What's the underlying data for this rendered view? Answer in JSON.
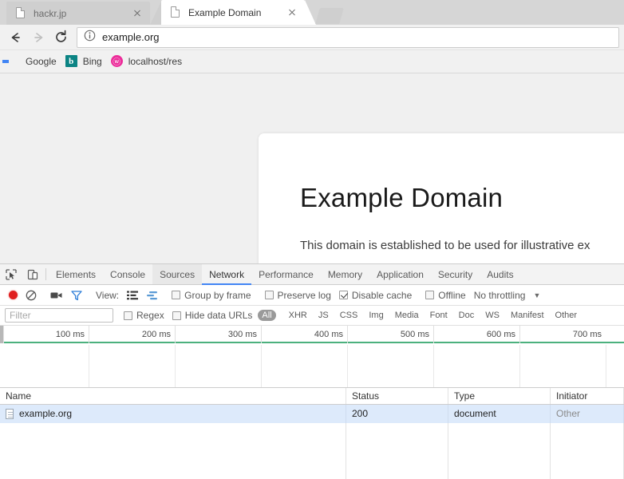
{
  "browser": {
    "tabs": [
      {
        "title": "hackr.jp",
        "active": false,
        "favicon": "page-icon"
      },
      {
        "title": "Example Domain",
        "active": true,
        "favicon": "page-icon"
      }
    ],
    "newtab_label": "New tab",
    "nav": {
      "back": "Back",
      "forward": "Forward",
      "reload": "Reload"
    },
    "omnibox": {
      "url": "example.org",
      "security_icon": "info-icon"
    },
    "bookmarks": [
      {
        "label": "Google",
        "icon": "google-icon",
        "glyph": ""
      },
      {
        "label": "Bing",
        "icon": "bing-icon",
        "glyph": "b"
      },
      {
        "label": "localhost/res",
        "icon": "localhost-icon",
        "glyph": "ⓦ"
      }
    ]
  },
  "page": {
    "heading": "Example Domain",
    "paragraph": "This domain is established to be used for illustrative ex"
  },
  "devtools": {
    "tabs": [
      {
        "label": "Elements",
        "state": "normal"
      },
      {
        "label": "Console",
        "state": "normal"
      },
      {
        "label": "Sources",
        "state": "hover"
      },
      {
        "label": "Network",
        "state": "active"
      },
      {
        "label": "Performance",
        "state": "normal"
      },
      {
        "label": "Memory",
        "state": "normal"
      },
      {
        "label": "Application",
        "state": "normal"
      },
      {
        "label": "Security",
        "state": "normal"
      },
      {
        "label": "Audits",
        "state": "normal"
      }
    ],
    "toolbar": {
      "record_title": "Stop recording network log",
      "clear_title": "Clear",
      "capture_screenshots_title": "Capture screenshots",
      "filter_title": "Filter",
      "view_label": "View:",
      "view_list_title": "List view",
      "view_waterfall_title": "Waterfall view",
      "group_by_frame_label": "Group by frame",
      "group_by_frame_checked": false,
      "preserve_log_label": "Preserve log",
      "preserve_log_checked": false,
      "disable_cache_label": "Disable cache",
      "disable_cache_checked": true,
      "offline_label": "Offline",
      "offline_checked": false,
      "throttling_label": "No throttling",
      "throttling_caret": "▼"
    },
    "filterbar": {
      "filter_placeholder": "Filter",
      "filter_value": "",
      "regex_label": "Regex",
      "regex_checked": false,
      "hide_data_urls_label": "Hide data URLs",
      "hide_data_urls_checked": false,
      "types": [
        {
          "label": "All",
          "selected": true
        },
        {
          "label": "XHR",
          "selected": false
        },
        {
          "label": "JS",
          "selected": false
        },
        {
          "label": "CSS",
          "selected": false
        },
        {
          "label": "Img",
          "selected": false
        },
        {
          "label": "Media",
          "selected": false
        },
        {
          "label": "Font",
          "selected": false
        },
        {
          "label": "Doc",
          "selected": false
        },
        {
          "label": "WS",
          "selected": false
        },
        {
          "label": "Manifest",
          "selected": false
        },
        {
          "label": "Other",
          "selected": false
        }
      ]
    },
    "overview": {
      "ticks": [
        "100 ms",
        "200 ms",
        "300 ms",
        "400 ms",
        "500 ms",
        "600 ms",
        "700 ms"
      ],
      "load_line_color": "#4cb17e"
    },
    "requests": {
      "columns": [
        "Name",
        "Status",
        "Type",
        "Initiator"
      ],
      "rows": [
        {
          "name": "example.org",
          "status": "200",
          "type": "document",
          "initiator": "Other",
          "selected": true
        }
      ]
    }
  }
}
